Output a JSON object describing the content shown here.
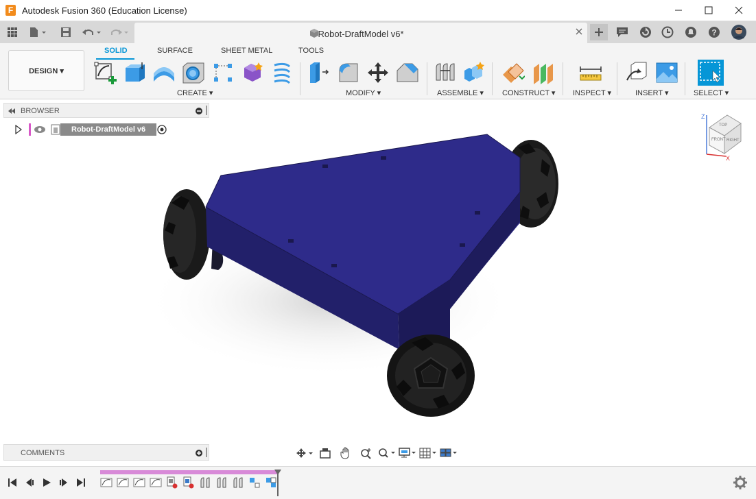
{
  "window": {
    "logo_letter": "F",
    "title": "Autodesk Fusion 360 (Education License)"
  },
  "document_tab": {
    "title": "Robot-DraftModel v6*"
  },
  "workspace": {
    "label": "DESIGN ▾"
  },
  "ribbon": {
    "tabs": [
      "SOLID",
      "SURFACE",
      "SHEET METAL",
      "TOOLS"
    ],
    "active_tab": "SOLID",
    "groups": [
      "CREATE ▾",
      "MODIFY ▾",
      "ASSEMBLE ▾",
      "CONSTRUCT ▾",
      "INSPECT ▾",
      "INSERT ▾",
      "SELECT ▾"
    ]
  },
  "browser": {
    "title": "BROWSER",
    "root_item": "Robot-DraftModel v6"
  },
  "comments": {
    "title": "COMMENTS"
  },
  "viewcube": {
    "top": "TOP",
    "front": "FRONT",
    "right": "RIGHT",
    "axis_z": "Z",
    "axis_x": "X"
  },
  "colors": {
    "accent": "#0696d7",
    "chassis": "#2a2478",
    "timeline": "#d88ad8",
    "logo": "#f28b1c"
  },
  "icons": {
    "minimize": "minimize-icon",
    "maximize": "maximize-icon",
    "close": "close-icon",
    "apps": "grid-icon",
    "settings": "gear-icon"
  }
}
